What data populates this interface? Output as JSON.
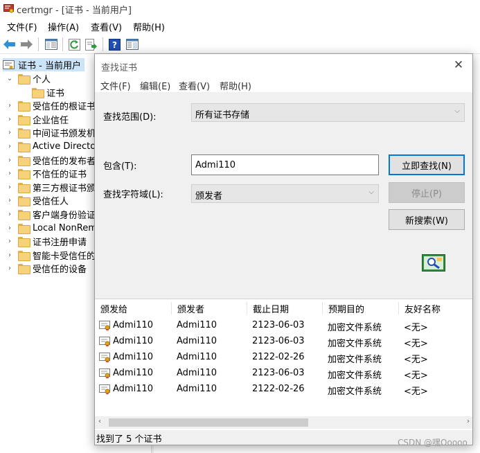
{
  "window": {
    "title": "certmgr - [证书 - 当前用户]",
    "menu": [
      "文件(F)",
      "操作(A)",
      "查看(V)",
      "帮助(H)"
    ]
  },
  "toolbar": {
    "icons": [
      "back-arrow-icon",
      "forward-arrow-icon",
      "console-tree-icon",
      "refresh-icon",
      "export-list-icon",
      "help-icon",
      "properties-pane-icon"
    ]
  },
  "tree": {
    "root": "证书 - 当前用户",
    "items": [
      {
        "label": "个人",
        "expanded": true
      },
      {
        "label": "证书",
        "child": true
      },
      {
        "label": "受信任的根证书"
      },
      {
        "label": "企业信任"
      },
      {
        "label": "中间证书颁发机"
      },
      {
        "label": "Active Director"
      },
      {
        "label": "受信任的发布者"
      },
      {
        "label": "不信任的证书"
      },
      {
        "label": "第三方根证书颁"
      },
      {
        "label": "受信任人"
      },
      {
        "label": "客户端身份验证"
      },
      {
        "label": "Local NonRem"
      },
      {
        "label": "证书注册申请"
      },
      {
        "label": "智能卡受信任的"
      },
      {
        "label": "受信任的设备"
      }
    ]
  },
  "dialog": {
    "title": "查找证书",
    "menu": [
      "文件(F)",
      "编辑(E)",
      "查看(V)",
      "帮助(H)"
    ],
    "scope_label": "查找范围(D):",
    "scope_value": "所有证书存储",
    "contains_label": "包含(T):",
    "contains_value": "Admi110",
    "field_label": "查找字符域(L):",
    "field_value": "颁发者",
    "buttons": {
      "find_now": "立即查找(N)",
      "stop": "停止(P)",
      "new_search": "新搜索(W)"
    },
    "columns": [
      "颁发给",
      "颁发者",
      "截止日期",
      "预期目的",
      "友好名称"
    ],
    "rows": [
      [
        "Admi110",
        "Admi110",
        "2123-06-03",
        "加密文件系统",
        "<无>"
      ],
      [
        "Admi110",
        "Admi110",
        "2123-06-03",
        "加密文件系统",
        "<无>"
      ],
      [
        "Admi110",
        "Admi110",
        "2122-02-26",
        "加密文件系统",
        "<无>"
      ],
      [
        "Admi110",
        "Admi110",
        "2123-06-03",
        "加密文件系统",
        "<无>"
      ],
      [
        "Admi110",
        "Admi110",
        "2122-02-26",
        "加密文件系统",
        "<无>"
      ]
    ],
    "status": "找到了 5 个证书"
  },
  "watermark": "CSDN @嘿Ooooo",
  "colors": {
    "accent": "#0078d7",
    "tree_selected": "#cce4f7",
    "dialog_bg": "#f0f0f0"
  }
}
